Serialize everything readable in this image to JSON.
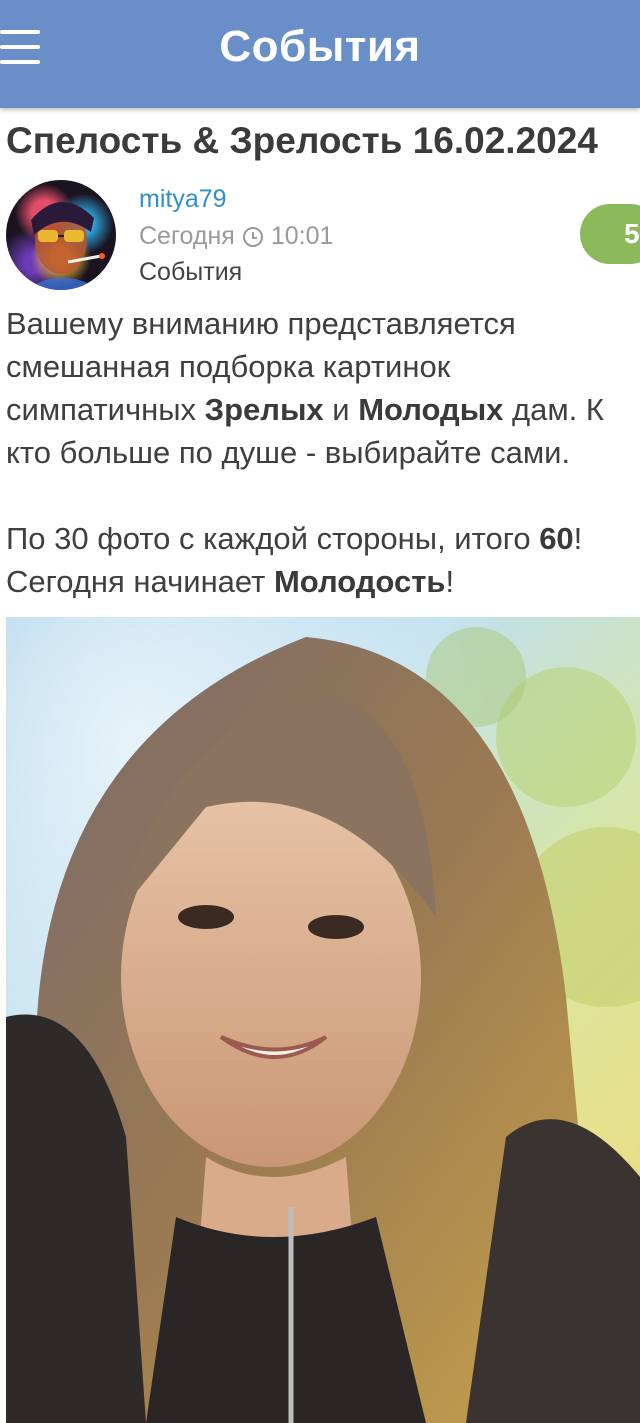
{
  "header": {
    "title": "События"
  },
  "post": {
    "title": "Спелость & Зрелость 16.02.2024",
    "author": "mitya79",
    "date": "Сегодня",
    "time": "10:01",
    "category": "События",
    "rating": "5",
    "text": {
      "line1": "Вашему вниманию представляется",
      "line2": "смешанная подборка картинок",
      "line3_pre": "симпатичных ",
      "line3_b1": "Зрелых",
      "line3_mid": " и ",
      "line3_b2": "Молодых",
      "line3_post": " дам. К",
      "line4": "кто больше по душе - выбирайте сами.",
      "line5_pre": "По 30 фото с каждой стороны, итого ",
      "line5_b": "60",
      "line5_post": "!",
      "line6_pre": "Сегодня начинает ",
      "line6_b": "Молодость",
      "line6_post": "!"
    }
  },
  "icons": {
    "menu": "hamburger-menu-icon",
    "clock": "clock-icon"
  },
  "colors": {
    "header_bg": "#6a8fc8",
    "author_link": "#2e8fc9",
    "rating_badge": "#8cba5a"
  }
}
